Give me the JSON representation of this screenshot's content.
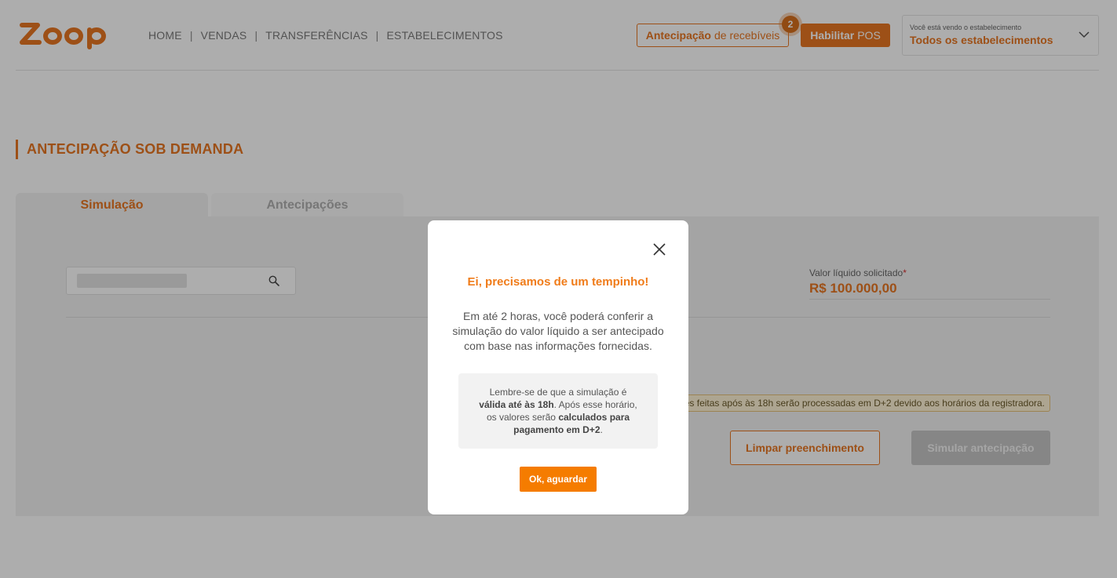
{
  "brand": {
    "logo_text": "zoop",
    "accent": "#e87722"
  },
  "nav": {
    "items": [
      "HOME",
      "VENDAS",
      "TRANSFERÊNCIAS",
      "ESTABELECIMENTOS"
    ],
    "separator": "|"
  },
  "header": {
    "antecipacao_bold": "Antecipação",
    "antecipacao_rest": "de recebíveis",
    "badge_count": "2",
    "pos_bold": "Habilitar",
    "pos_rest": "POS",
    "estab_caption": "Você está vendo o estabelecimento",
    "estab_value": "Todos os estabelecimentos"
  },
  "page": {
    "title": "ANTECIPAÇÃO SOB DEMANDA",
    "tabs": [
      {
        "label": "Simulação",
        "active": true
      },
      {
        "label": "Antecipações",
        "active": false
      }
    ]
  },
  "form": {
    "valor_label": "Valor líquido solicitado",
    "valor_required": "*",
    "valor_value": "R$ 100.000,00",
    "notice": "es feitas após às 18h serão processadas em D+2 devido aos horários da registradora.",
    "clear_label": "Limpar preenchimento",
    "simulate_label": "Simular antecipação"
  },
  "modal": {
    "title": "Ei, precisamos de um tempinho!",
    "text": "Em até 2 horas, você poderá conferir a simulação do valor líquido a ser antecipado com base nas informações fornecidas.",
    "box": {
      "p1": "Lembre-se de que a simulação é ",
      "b1": "válida até às 18h",
      "p2": ". Após esse horário, os valores serão ",
      "b2": "calculados para pagamento em D+2",
      "p3": "."
    },
    "ok_label": "Ok, aguardar"
  }
}
